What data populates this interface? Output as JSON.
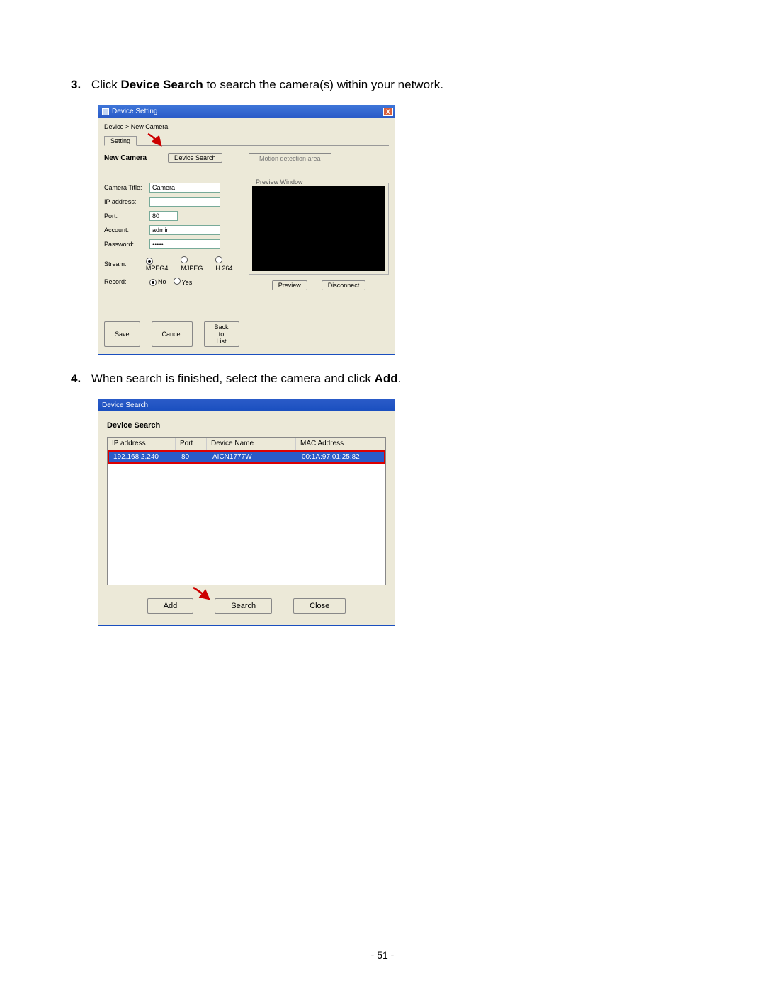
{
  "steps": {
    "s3_num": "3.",
    "s3_pre": "Click ",
    "s3_bold": "Device Search",
    "s3_post": " to search the camera(s) within your network.",
    "s4_num": "4.",
    "s4_pre": "When search is finished, select the camera and click ",
    "s4_bold": "Add",
    "s4_post": "."
  },
  "win1": {
    "title": "Device Setting",
    "close": "X",
    "breadcrumb": "Device > New Camera",
    "tab": "Setting",
    "new_camera_label": "New Camera",
    "device_search_btn": "Device Search",
    "motion_btn": "Motion detection area",
    "labels": {
      "camera_title": "Camera Title:",
      "ip": "IP address:",
      "port": "Port:",
      "account": "Account:",
      "password": "Password:",
      "stream": "Stream:",
      "record": "Record:"
    },
    "values": {
      "camera_title": "Camera",
      "ip": "",
      "port": "80",
      "account": "admin",
      "password": "•••••"
    },
    "stream": {
      "mpeg4": "MPEG4",
      "mjpeg": "MJPEG",
      "h264": "H.264"
    },
    "record": {
      "no": "No",
      "yes": "Yes"
    },
    "preview_label": "Preview Window",
    "preview_btn": "Preview",
    "disconnect_btn": "Disconnect",
    "save_btn": "Save",
    "cancel_btn": "Cancel",
    "back_btn": "Back to List"
  },
  "win2": {
    "title": "Device Search",
    "heading": "Device Search",
    "headers": {
      "ip": "IP address",
      "port": "Port",
      "name": "Device Name",
      "mac": "MAC Address"
    },
    "row": {
      "ip": "192.168.2.240",
      "port": "80",
      "name": "AICN1777W",
      "mac": "00:1A:97:01:25:82"
    },
    "add_btn": "Add",
    "search_btn": "Search",
    "close_btn": "Close"
  },
  "page_num": "- 51 -"
}
